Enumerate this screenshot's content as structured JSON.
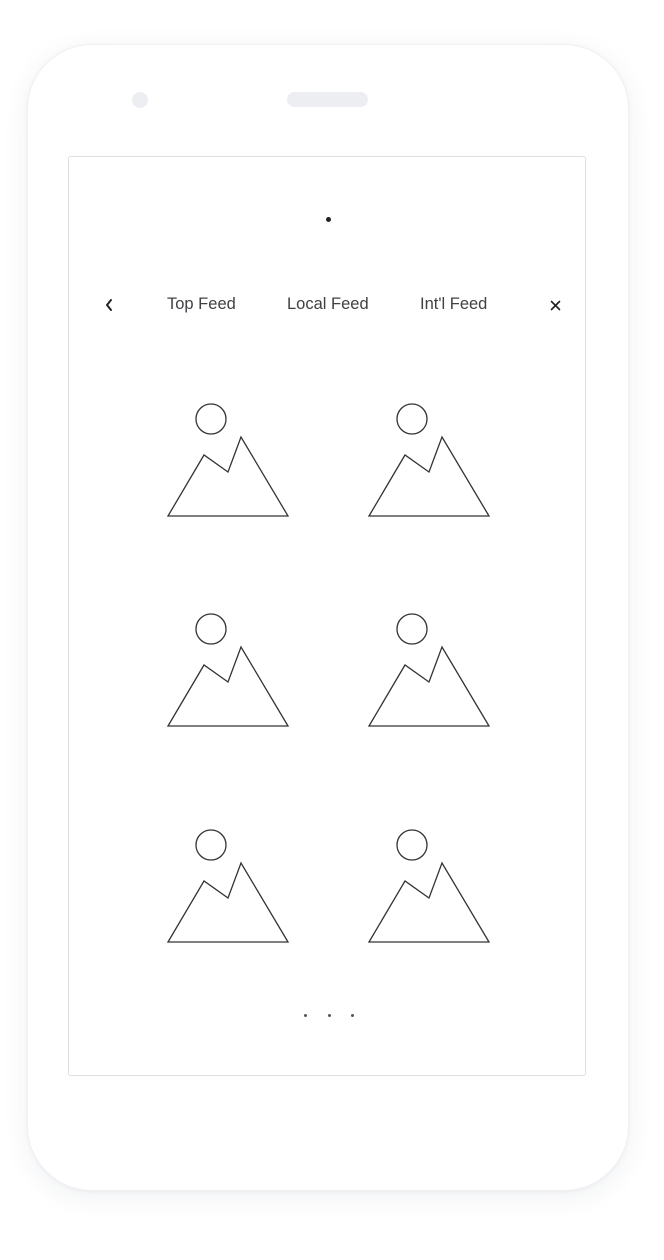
{
  "nav": {
    "tabs": [
      {
        "label": "Top Feed"
      },
      {
        "label": "Local Feed"
      },
      {
        "label": "Int'l Feed"
      }
    ],
    "back_icon": "chevron-left-icon",
    "close_icon": "close-icon"
  },
  "gallery": {
    "items": [
      {
        "icon": "image-placeholder-icon"
      },
      {
        "icon": "image-placeholder-icon"
      },
      {
        "icon": "image-placeholder-icon"
      },
      {
        "icon": "image-placeholder-icon"
      },
      {
        "icon": "image-placeholder-icon"
      },
      {
        "icon": "image-placeholder-icon"
      }
    ]
  },
  "pager": {
    "icon": "more-dots-icon"
  },
  "colors": {
    "stroke": "#333333",
    "tab_text": "#3f4144",
    "device_accent": "#eceef2",
    "screen_border": "#dcdfe4"
  }
}
